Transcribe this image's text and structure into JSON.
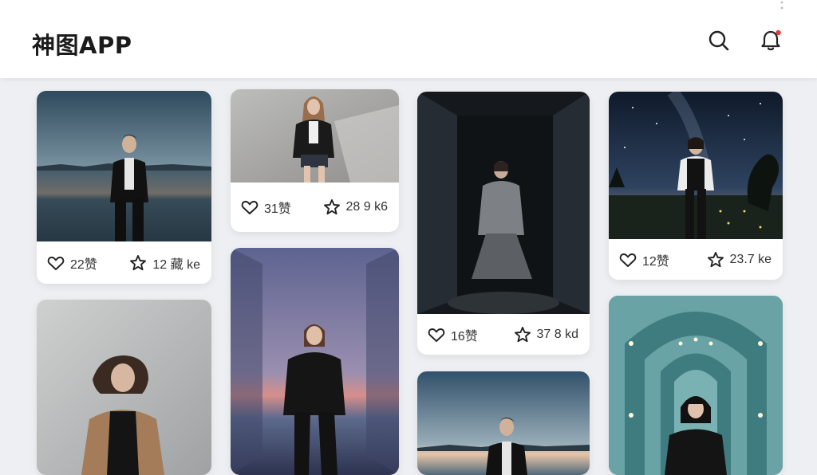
{
  "app": {
    "title": "神图APP"
  },
  "header": {
    "search_icon": "search-icon",
    "bell_icon": "bell-icon",
    "bell_badge_color": "#e53935"
  },
  "cards": [
    {
      "like_text": "22赞",
      "fav_text": "12 藏 ke"
    },
    {
      "like_text": "31赞",
      "fav_text": "28 9 k6"
    },
    {
      "like_text": "16赞",
      "fav_text": "37 8 kd"
    },
    {
      "like_text": "12赞",
      "fav_text": "23.7 ke"
    }
  ]
}
